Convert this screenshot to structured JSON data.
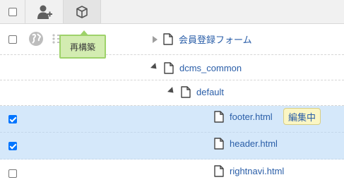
{
  "toolbar": {
    "user_icon": "user-add-icon",
    "rebuild_icon": "cube-icon",
    "tooltip": "再構築"
  },
  "tree": [
    {
      "label": "会員登録フォーム",
      "type": "file",
      "expander": "collapsed",
      "checked": false
    },
    {
      "label": "dcms_common",
      "type": "file",
      "expander": "expanded",
      "checked": null
    },
    {
      "label": "default",
      "type": "file",
      "expander": "expanded",
      "checked": null
    },
    {
      "label": "footer.html",
      "type": "file",
      "checked": true,
      "status_badge": "編集中"
    },
    {
      "label": "header.html",
      "type": "file",
      "checked": true
    },
    {
      "label": "rightnavi.html",
      "type": "file",
      "checked": false
    }
  ],
  "colors": {
    "selected_row": "#d5e8fa",
    "tooltip_bg": "#d3ecb1",
    "badge_bg": "#fbf6c4",
    "link": "#2a5ea8"
  }
}
